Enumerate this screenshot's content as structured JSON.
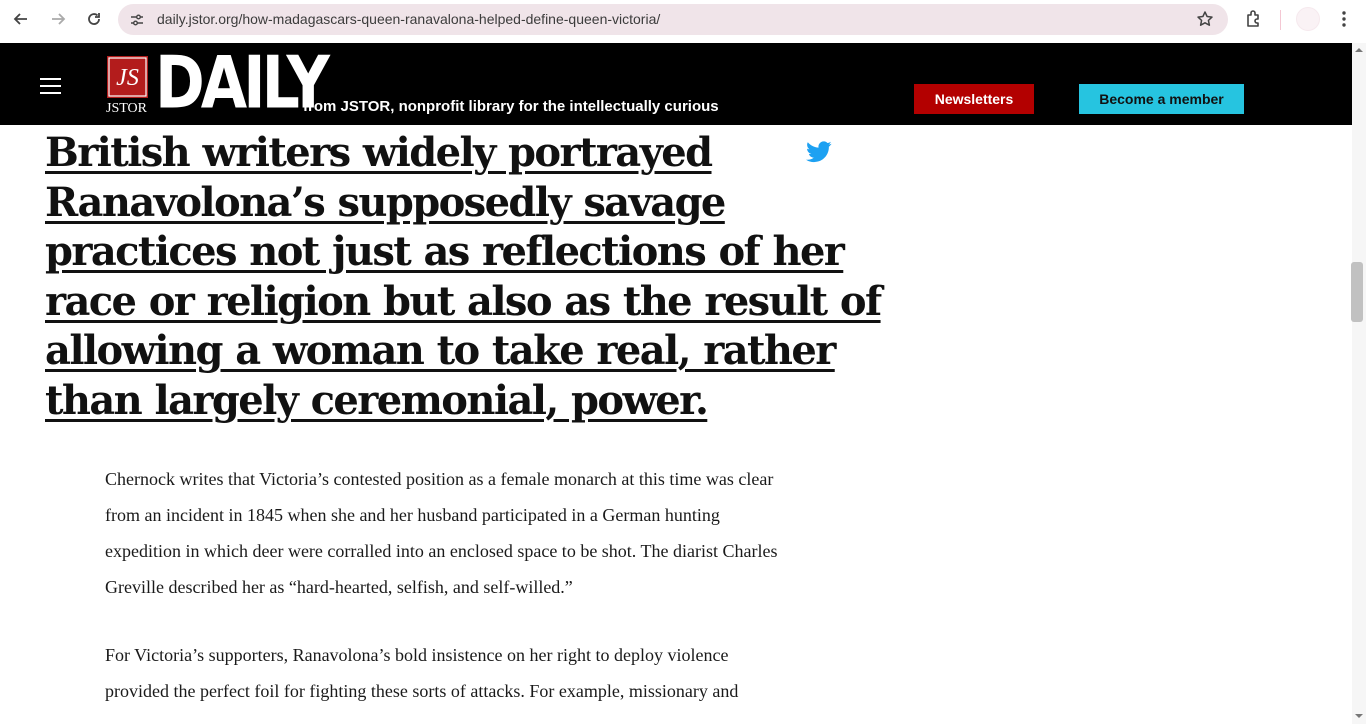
{
  "browser": {
    "url": "daily.jstor.org/how-madagascars-queen-ranavalona-helped-define-queen-victoria/",
    "icons": [
      "back-icon",
      "forward-icon",
      "reload-icon",
      "site-settings-icon",
      "bookmark-star-icon",
      "extensions-icon",
      "profile-avatar",
      "menu-kebab-icon"
    ]
  },
  "header": {
    "logo_sub": "JSTOR",
    "logo_main": "DAILY",
    "tagline": "from JSTOR, nonprofit library for the intellectually curious",
    "newsletters_label": "Newsletters",
    "member_label": "Become a member",
    "colors": {
      "background": "#000000",
      "newsletters_bg": "#b30000",
      "member_bg": "#26c4e0",
      "logo_red": "#b31c1c"
    }
  },
  "article": {
    "pullquote_lines": [
      "British writers widely portrayed",
      "Ranavolona’s supposedly savage",
      "practices not just as reflections of her",
      "race or religion but also as the result of",
      "allowing a woman to take real, rather",
      "than largely ceremonial, power."
    ],
    "share_icon": "twitter-icon",
    "paragraph1_lines": [
      "Chernock writes that Victoria’s contested position as a female monarch at this time was clear",
      "from an incident in 1845 when she and her husband participated in a German hunting",
      "expedition in which deer were corralled into an enclosed space to be shot. The diarist Charles",
      "Greville described her as “hard-hearted, selfish, and self-willed.”"
    ],
    "paragraph2_lines": [
      "For Victoria’s supporters, Ranavolona’s bold insistence on her right to deploy violence",
      "provided the perfect foil for fighting these sorts of attacks. For example, missionary and"
    ]
  }
}
